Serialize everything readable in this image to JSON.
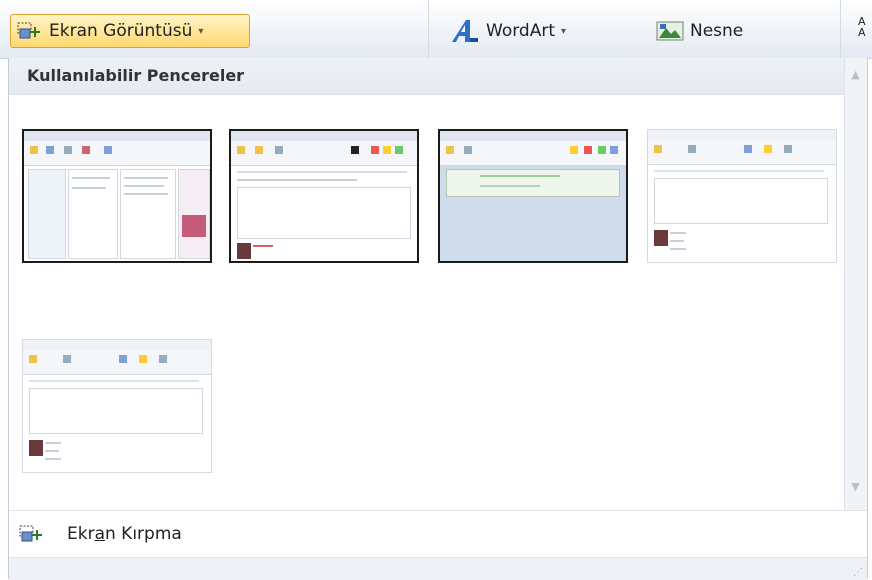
{
  "ribbon": {
    "screenshot_label": "Ekran Görüntüsü",
    "wordart_label": "WordArt",
    "object_label": "Nesne"
  },
  "gallery": {
    "header": "Kullanılabilir Pencereler",
    "windows": [
      {
        "selected": true
      },
      {
        "selected": true
      },
      {
        "selected": true
      },
      {
        "selected": false
      },
      {
        "selected": false
      }
    ]
  },
  "screen_clipping": {
    "label_pre": "Ekr",
    "label_mnemonic": "a",
    "label_post": "n Kırpma"
  },
  "colors": {
    "active_button": "#ffd96f",
    "selected_border": "#1b1b1b",
    "wordart_blue": "#2e6fc8"
  }
}
